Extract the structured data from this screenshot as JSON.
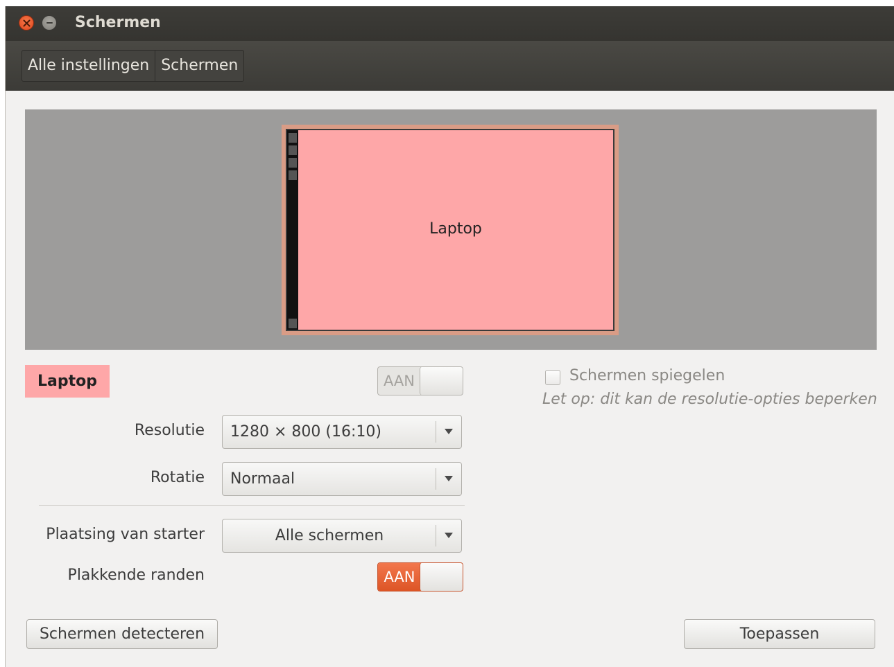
{
  "window": {
    "title": "Schermen"
  },
  "breadcrumb": {
    "items": [
      "Alle instellingen",
      "Schermen"
    ]
  },
  "preview": {
    "monitor_label": "Laptop"
  },
  "display": {
    "name": "Laptop",
    "power_switch": {
      "label": "AAN",
      "state": "off"
    }
  },
  "mirror": {
    "label": "Schermen spiegelen",
    "checked": false,
    "note": "Let op: dit kan de resolutie-opties beperken"
  },
  "fields": {
    "resolution": {
      "label": "Resolutie",
      "value": "1280 × 800 (16:10)"
    },
    "rotation": {
      "label": "Rotatie",
      "value": "Normaal"
    },
    "launcher_placement": {
      "label": "Plaatsing van starter",
      "value": "Alle schermen"
    },
    "sticky_edges": {
      "label": "Plakkende randen",
      "switch_label": "AAN",
      "state": "on"
    }
  },
  "buttons": {
    "detect": "Schermen detecteren",
    "apply": "Toepassen"
  },
  "colors": {
    "accent_orange": "#dd5526",
    "monitor_fill": "#fea7a8"
  }
}
